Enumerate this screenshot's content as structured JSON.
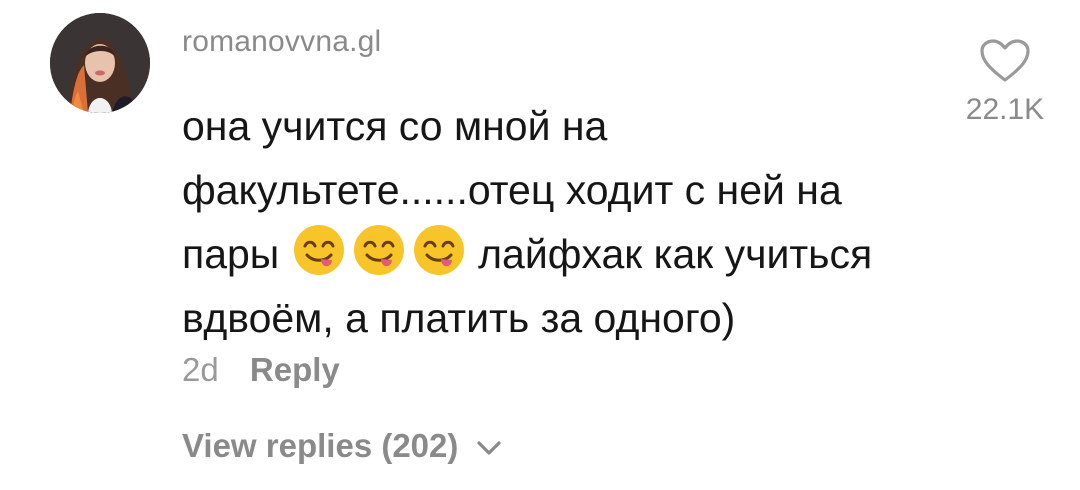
{
  "comment": {
    "username": "romanovvna.gl",
    "text_lines": [
      "она учится со мной на",
      "факультете......отец ходит с ней на",
      "пары",
      "лайфхак как учиться",
      "вдвоём, а платить за одного)"
    ],
    "emoji": [
      "savoring-food-emoji",
      "savoring-food-emoji",
      "savoring-food-emoji"
    ],
    "time_ago": "2d",
    "reply_label": "Reply",
    "view_replies_label": "View replies (202)",
    "like_count": "22.1K"
  },
  "icons": {
    "like": "heart-outline-icon",
    "expand": "chevron-down-icon"
  },
  "colors": {
    "text_primary": "#161616",
    "text_secondary": "#8a8a8a",
    "emoji_face": "#f7c52a",
    "emoji_tongue": "#e35a7a"
  }
}
